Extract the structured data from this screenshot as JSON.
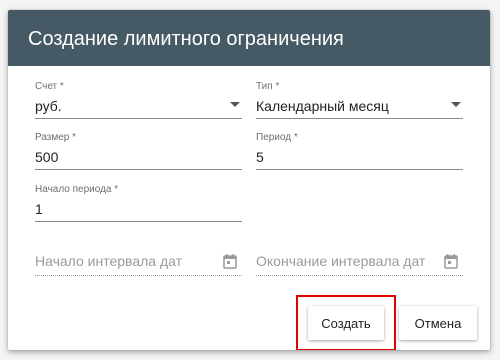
{
  "dialog": {
    "title": "Создание лимитного ограничения",
    "header_color": "#455a64"
  },
  "form": {
    "account": {
      "label": "Счет *",
      "value": "руб."
    },
    "type": {
      "label": "Тип *",
      "value": "Календарный месяц"
    },
    "size": {
      "label": "Размер *",
      "value": "500"
    },
    "period": {
      "label": "Период *",
      "value": "5"
    },
    "period_start": {
      "label": "Начало периода *",
      "value": "1"
    },
    "date_interval_start": {
      "placeholder": "Начало интервала дат",
      "icon": "calendar-icon"
    },
    "date_interval_end": {
      "placeholder": "Окончание интервала дат",
      "icon": "calendar-icon"
    }
  },
  "actions": {
    "create_label": "Создать",
    "cancel_label": "Отмена",
    "highlight_color": "#e00000"
  }
}
